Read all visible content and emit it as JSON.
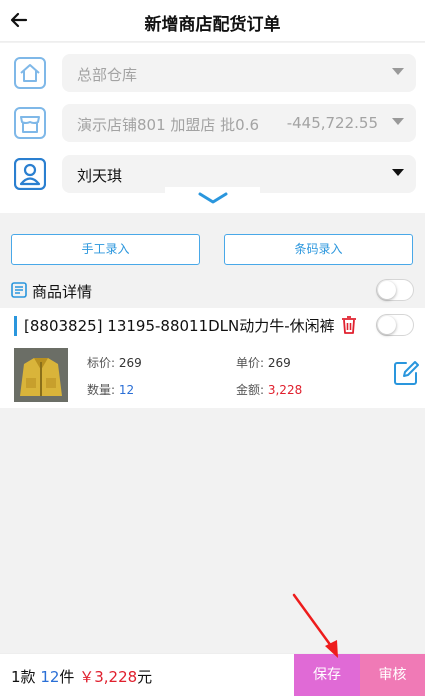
{
  "header": {
    "title": "新增商店配货订单"
  },
  "form": {
    "warehouse": {
      "placeholder": "总部仓库"
    },
    "store": {
      "name": "演示店铺801 加盟店 批0.6",
      "balance": "-445,722.55"
    },
    "user": {
      "name": "刘天琪"
    }
  },
  "actions": {
    "manual_label": "手工录入",
    "barcode_label": "条码录入"
  },
  "detail": {
    "label": "商品详情"
  },
  "product": {
    "name": "[8803825] 13195-88011DLN动力牛-休闲裤",
    "tag_price_label": "标价: ",
    "tag_price": "269",
    "unit_price_label": "单价: ",
    "unit_price": "269",
    "qty_label": "数量: ",
    "qty": "12",
    "amount_label": "金额: ",
    "amount": "3,228"
  },
  "footer": {
    "kinds": "1款",
    "pieces_num": "12",
    "pieces_unit": "件",
    "total": "￥3,228",
    "currency_unit": "元",
    "save_label": "保存",
    "audit_label": "审核"
  },
  "colors": {
    "accent": "#2a96dd",
    "save": "#e06ad6",
    "audit": "#f07ab6",
    "amount_red": "#e0202e"
  }
}
